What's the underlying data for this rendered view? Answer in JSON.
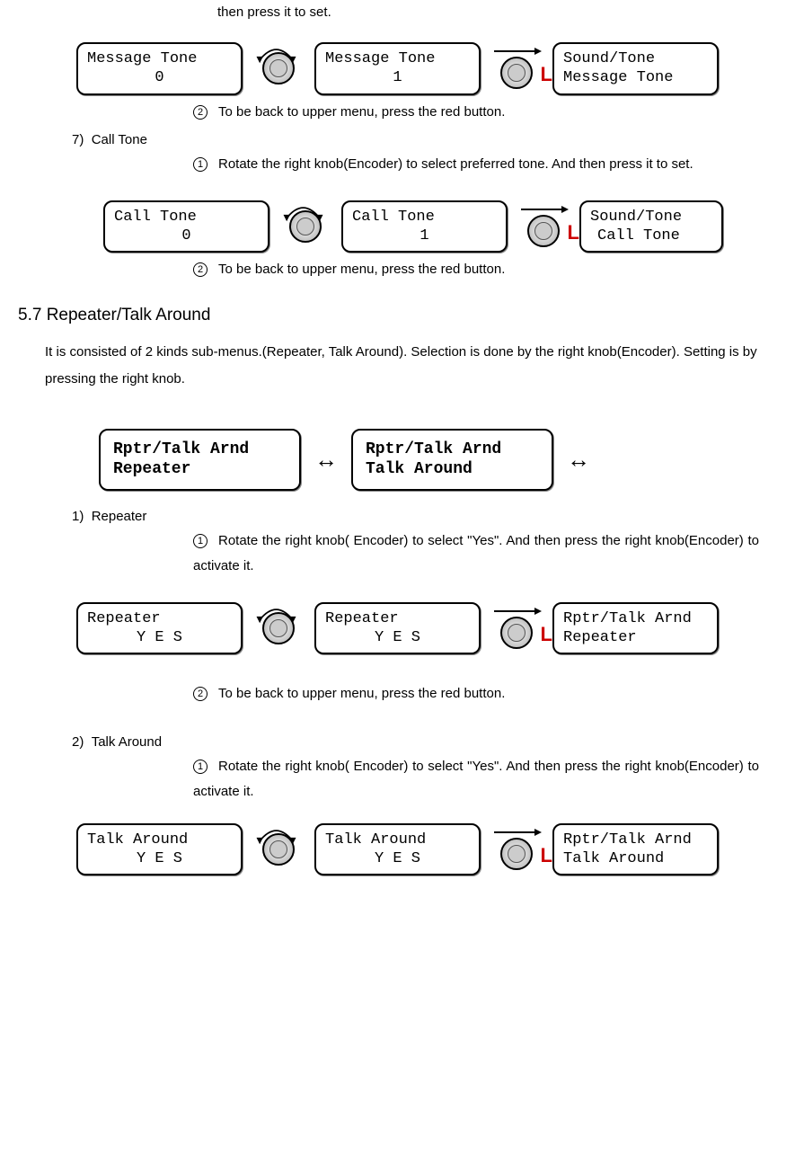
{
  "top_fragment": "then press it to set.",
  "message_tone_row": {
    "box1": {
      "line1": "Message Tone",
      "line2": "0"
    },
    "box2": {
      "line1": "Message Tone",
      "line2": "1"
    },
    "box3": {
      "line1": "Sound/Tone",
      "line2": "Message Tone"
    }
  },
  "step_back_upper": "To be back to upper menu, press the red button.",
  "item7": {
    "num": "7)",
    "title": "Call Tone",
    "step1": "Rotate the right knob(Encoder) to select preferred tone. And then press it to set."
  },
  "call_tone_row": {
    "box1": {
      "line1": "Call Tone",
      "line2": "0"
    },
    "box2": {
      "line1": "Call Tone",
      "line2": "1"
    },
    "box3": {
      "line1": "Sound/Tone",
      "line2": "Call Tone"
    }
  },
  "section57": {
    "heading": "5.7 Repeater/Talk Around",
    "body": "It is consisted of 2 kinds sub-menus.(Repeater, Talk Around). Selection is done by the right knob(Encoder). Setting is by pressing the right knob."
  },
  "rptr_row": {
    "box1": {
      "line1": "Rptr/Talk Arnd",
      "line2": "Repeater"
    },
    "box2": {
      "line1": "Rptr/Talk Arnd",
      "line2": "Talk Around"
    }
  },
  "item1": {
    "num": "1)",
    "title": "Repeater",
    "step1": "Rotate the right knob( Encoder) to select \"Yes\". And then press the right knob(Encoder) to activate it."
  },
  "repeater_row": {
    "box1": {
      "line1": "Repeater",
      "line2": "Y E S"
    },
    "box2": {
      "line1": "Repeater",
      "line2": "Y E S"
    },
    "box3": {
      "line1": "Rptr/Talk Arnd",
      "line2": "Repeater"
    }
  },
  "item2": {
    "num": "2)",
    "title": "Talk Around",
    "step1": "Rotate the right knob( Encoder) to select \"Yes\". And then press the right knob(Encoder) to activate it."
  },
  "talk_around_row": {
    "box1": {
      "line1": "Talk Around",
      "line2": "Y E S"
    },
    "box2": {
      "line1": "Talk Around",
      "line2": "Y E S"
    },
    "box3": {
      "line1": "Rptr/Talk Arnd",
      "line2": "Talk Around"
    }
  },
  "circled": {
    "one": "1",
    "two": "2"
  }
}
